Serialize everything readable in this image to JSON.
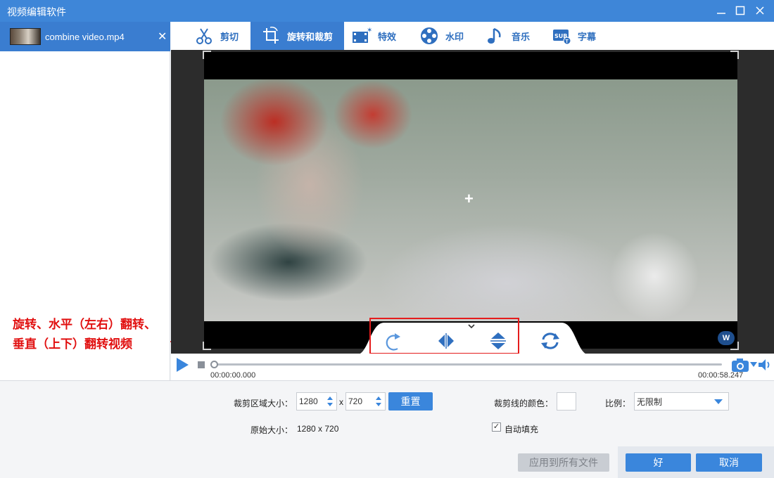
{
  "window": {
    "title": "视频编辑软件"
  },
  "file": {
    "name": "combine video.mp4",
    "close_glyph": "✕"
  },
  "tabs": [
    {
      "label": "剪切",
      "icon": "scissors-icon"
    },
    {
      "label": "旋转和裁剪",
      "icon": "crop-rotate-icon"
    },
    {
      "label": "特效",
      "icon": "film-effect-icon"
    },
    {
      "label": "水印",
      "icon": "watermark-reel-icon"
    },
    {
      "label": "音乐",
      "icon": "music-note-icon"
    },
    {
      "label": "字幕",
      "icon": "subtitle-icon"
    }
  ],
  "annotation": {
    "line1": "旋转、水平（左右）翻转、",
    "line2": "垂直（上下）翻转视频"
  },
  "preview": {
    "watermark_badge": "W"
  },
  "playback": {
    "current_time": "00:00:00.000",
    "total_time": "00:00:58.247",
    "progress": 0
  },
  "crop": {
    "area_label": "裁剪区域大小：",
    "width": "1280",
    "separator": "x",
    "height": "720",
    "reset_label": "重置",
    "original_label": "原始大小：",
    "original_value": "1280 x 720",
    "line_color_label": "裁剪线的颜色：",
    "ratio_label": "比例：",
    "ratio_value": "无限制",
    "autofill_label": "自动填充",
    "autofill_checked": true
  },
  "footer": {
    "apply_all": "应用到所有文件",
    "ok": "好",
    "cancel": "取消"
  },
  "colors": {
    "title_bar": "#3e86d8",
    "accent": "#3a7dd0",
    "annotation_red": "#e10f0f"
  }
}
